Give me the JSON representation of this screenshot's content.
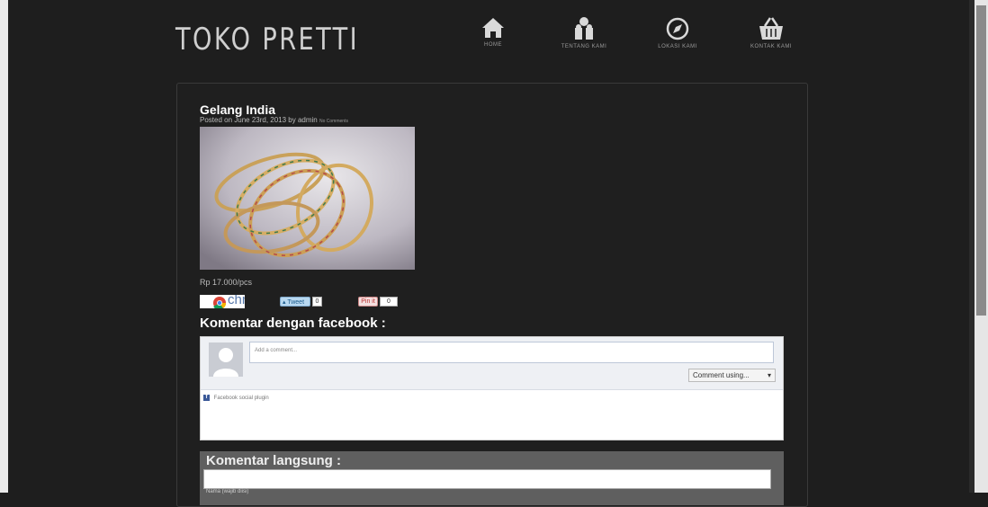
{
  "site": {
    "logo": "TOKO  PRETTI"
  },
  "nav": [
    {
      "label": "HOME",
      "icon": "home-icon"
    },
    {
      "label": "TENTANG KAMI",
      "icon": "people-icon"
    },
    {
      "label": "LOKASI KAMI",
      "icon": "compass-icon"
    },
    {
      "label": "KONTAK KAMI",
      "icon": "basket-icon"
    }
  ],
  "post": {
    "title": "Gelang India",
    "meta": "Posted on June 23rd, 2013 by admin",
    "meta_comments": "No Comments",
    "price": "Rp 17.000/pcs"
  },
  "share": {
    "chrome_text": "chr",
    "tweet_label": "Tweet",
    "tweet_count": "0",
    "pin_label": "Pin it",
    "pin_count": "0"
  },
  "facebook": {
    "heading": "Komentar dengan facebook :",
    "placeholder": "Add a comment...",
    "comment_using": "Comment using...",
    "plugin_text": "Facebook social plugin"
  },
  "direct": {
    "heading": "Komentar langsung :",
    "field_label": "Nama (wajib diisi)"
  },
  "colors": {
    "background": "#1e1e1e",
    "facebook_blue": "#3b5998",
    "nav_icon": "#d9d9d9"
  }
}
